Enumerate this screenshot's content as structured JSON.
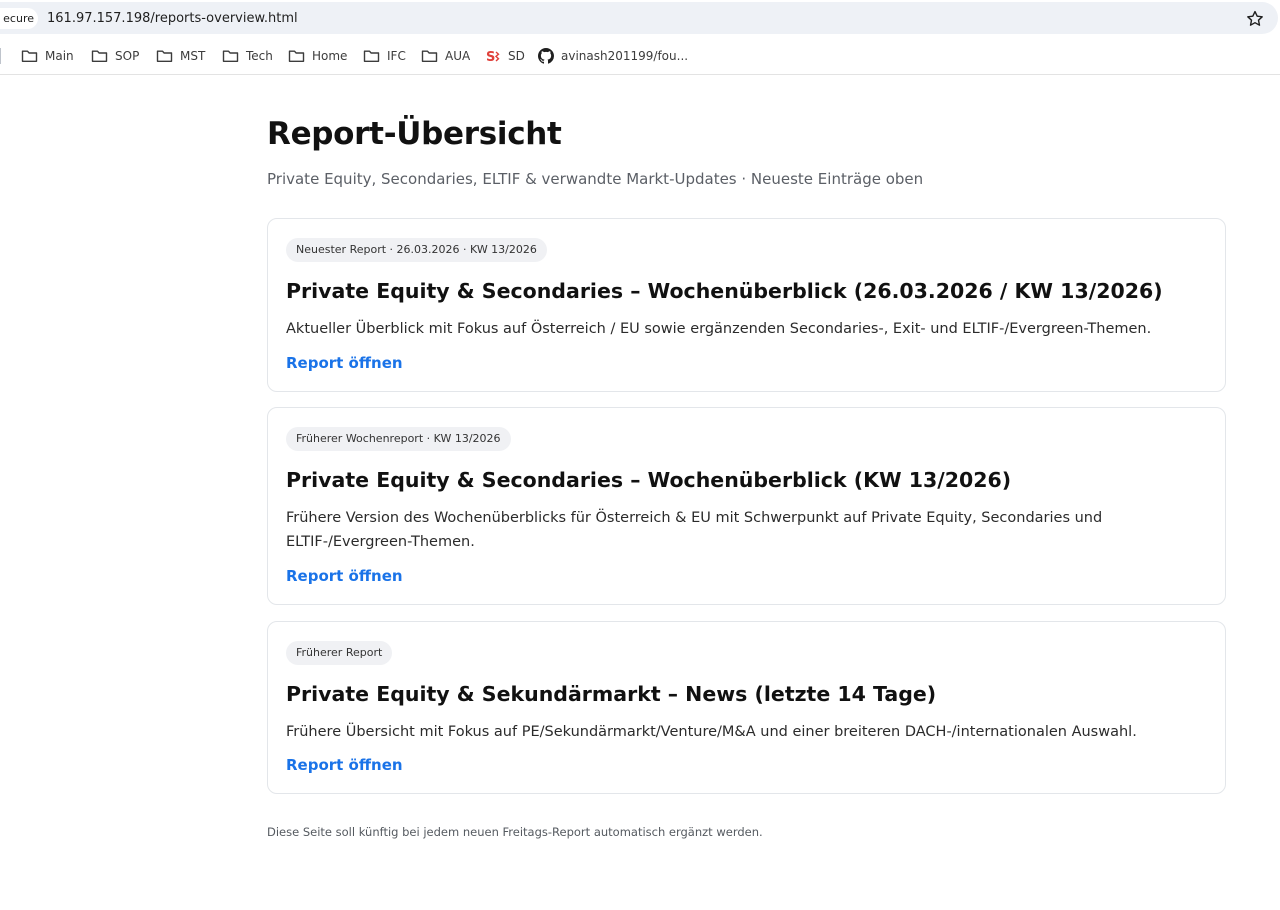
{
  "browser": {
    "security_chip": "ecure",
    "url": "161.97.157.198/reports-overview.html",
    "bookmarks": [
      {
        "label": "Main",
        "icon": "folder-icon"
      },
      {
        "label": "SOP",
        "icon": "folder-icon"
      },
      {
        "label": "MST",
        "icon": "folder-icon"
      },
      {
        "label": "Tech",
        "icon": "folder-icon"
      },
      {
        "label": "Home",
        "icon": "folder-icon"
      },
      {
        "label": "IFC",
        "icon": "folder-icon"
      },
      {
        "label": "AUA",
        "icon": "folder-icon"
      },
      {
        "label": "SD",
        "icon": "sd-logo-icon"
      },
      {
        "label": "avinash201199/fou...",
        "icon": "github-icon"
      }
    ]
  },
  "page": {
    "title": "Report-Übersicht",
    "subtitle": "Private Equity, Secondaries, ELTIF & verwandte Markt-Updates · Neueste Einträge oben",
    "reports": [
      {
        "badge": "Neuester Report · 26.03.2026 · KW 13/2026",
        "title": "Private Equity & Secondaries – Wochenüberblick (26.03.2026 / KW 13/2026)",
        "description": "Aktueller Überblick mit Fokus auf Österreich / EU sowie ergänzenden Secondaries-, Exit- und ELTIF-/Evergreen-Themen.",
        "link": "Report öffnen"
      },
      {
        "badge": "Früherer Wochenreport · KW 13/2026",
        "title": "Private Equity & Secondaries – Wochenüberblick (KW 13/2026)",
        "description": "Frühere Version des Wochenüberblicks für Österreich & EU mit Schwerpunkt auf Private Equity, Secondaries und ELTIF-/Evergreen-Themen.",
        "link": "Report öffnen"
      },
      {
        "badge": "Früherer Report",
        "title": "Private Equity & Sekundärmarkt – News (letzte 14 Tage)",
        "description": "Frühere Übersicht mit Fokus auf PE/Sekundärmarkt/Venture/M&A und einer breiteren DACH-/internationalen Auswahl.",
        "link": "Report öffnen"
      }
    ],
    "footer_note": "Diese Seite soll künftig bei jedem neuen Freitags-Report automatisch ergänzt werden."
  },
  "colors": {
    "link": "#1a73e8",
    "badge_bg": "#f0f1f4",
    "card_border": "#e3e6ea",
    "omnibar_bg": "#eef1f6"
  }
}
